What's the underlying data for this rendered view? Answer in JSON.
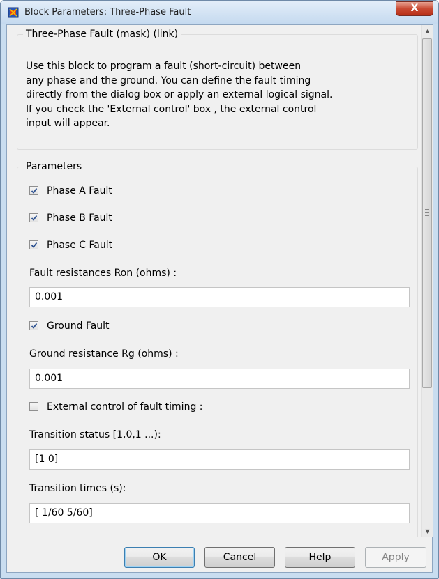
{
  "window": {
    "title": "Block Parameters: Three-Phase Fault",
    "close_symbol": "X"
  },
  "description_group": {
    "legend": "Three-Phase Fault (mask) (link)",
    "lines": [
      "Use this block to program a fault (short-circuit) between",
      "any phase and the ground. You can define the fault timing",
      "directly from the dialog box or apply an external logical signal.",
      "If you check the 'External control' box , the external control",
      "input will appear."
    ]
  },
  "parameters": {
    "legend": "Parameters",
    "phase_a": {
      "label": "Phase A Fault",
      "checked": true
    },
    "phase_b": {
      "label": "Phase B Fault",
      "checked": true
    },
    "phase_c": {
      "label": "Phase C Fault",
      "checked": true
    },
    "fault_resistance": {
      "label": "Fault resistances  Ron (ohms) :",
      "value": "0.001"
    },
    "ground_fault": {
      "label": "Ground Fault",
      "checked": true
    },
    "ground_resistance": {
      "label": "Ground resistance Rg (ohms) :",
      "value": "0.001"
    },
    "external_control": {
      "label": "External control of fault timing :",
      "checked": false
    },
    "transition_status": {
      "label": "Transition status [1,0,1 ...):",
      "value": "[1 0]"
    },
    "transition_times": {
      "label": "Transition times (s):",
      "value": "[ 1/60 5/60]"
    }
  },
  "buttons": {
    "ok": "OK",
    "cancel": "Cancel",
    "help": "Help",
    "apply": "Apply"
  },
  "colors": {
    "titlebar": "#c4d9ef",
    "close_button": "#c94a33",
    "dialog_bg": "#f0f0f0",
    "check": "#2a4f8f"
  }
}
